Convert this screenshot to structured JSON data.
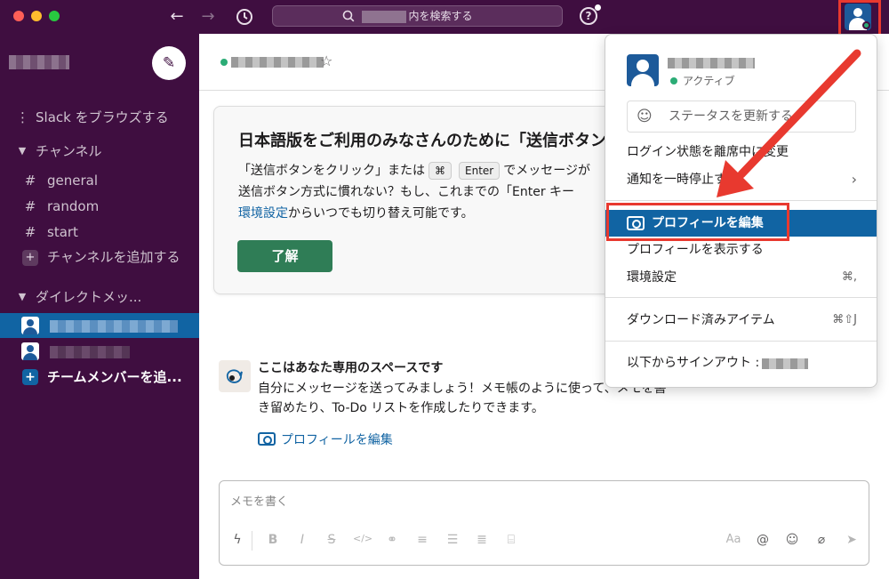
{
  "titlebar": {
    "search_placeholder": "内を検索する",
    "back_icon": "arrow-left-icon",
    "forward_icon": "arrow-right-icon",
    "history_icon": "clock-icon",
    "help_label": "?"
  },
  "sidebar": {
    "browse_label": "Slack をブラウズする",
    "channels_header": "チャンネル",
    "channels": [
      "general",
      "random",
      "start"
    ],
    "add_channel_label": "チャンネルを追加する",
    "dm_header": "ダイレクトメッ...",
    "add_team_label": "チームメンバーを追..."
  },
  "banner": {
    "title": "日本語版をご利用のみなさんのために「送信ボタン",
    "line1_before": "「送信ボタンをクリック」または",
    "key_cmd": "⌘",
    "key_enter": "Enter",
    "line1_after": "でメッセージが",
    "line2": "送信ボタン方式に慣れない？もし、これまでの「Enter キー",
    "line3_link": "環境設定",
    "line3_after": "からいつでも切り替え可能です。",
    "ok_label": "了解"
  },
  "self_space": {
    "title": "ここはあなた専用のスペースです",
    "text": "自分にメッセージを送ってみましょう！メモ帳のように使って、メモを書き留めたり、To-Do リストを作成したりできます。",
    "edit_profile_link": "プロフィールを編集"
  },
  "composer": {
    "placeholder": "メモを書く",
    "text_style_label": "Aa"
  },
  "menu": {
    "status_active": "アクティブ",
    "status_placeholder": "ステータスを更新する",
    "set_away": "ログイン状態を離席中に変更",
    "pause_notifications": "通知を一時停止する",
    "pause_chevron": "›",
    "edit_profile": "プロフィールを編集",
    "view_profile": "プロフィールを表示する",
    "preferences": "環境設定",
    "preferences_shortcut": "⌘,",
    "downloads": "ダウンロード済みアイテム",
    "downloads_shortcut": "⌘⇧J",
    "sign_out": "以下からサインアウト :"
  },
  "colors": {
    "sidebar_bg": "#3f0e40",
    "selection": "#1164a3",
    "presence": "#2bac76",
    "primary_button": "#2f7d56",
    "annotation_red": "#e8392f"
  }
}
